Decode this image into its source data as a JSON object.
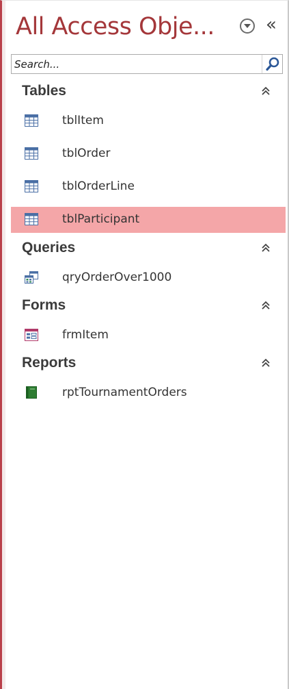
{
  "pane": {
    "title": "All Access Obje...",
    "accent_color": "#a4373a",
    "selection_color": "#f4a6a8"
  },
  "search": {
    "placeholder": "Search..."
  },
  "groups": [
    {
      "label": "Tables",
      "items": [
        "tblItem",
        "tblOrder",
        "tblOrderLine",
        "tblParticipant"
      ],
      "icon": "table-icon"
    },
    {
      "label": "Queries",
      "items": [
        "qryOrderOver1000"
      ],
      "icon": "query-icon"
    },
    {
      "label": "Forms",
      "items": [
        "frmItem"
      ],
      "icon": "form-icon"
    },
    {
      "label": "Reports",
      "items": [
        "rptTournamentOrders"
      ],
      "icon": "report-icon"
    }
  ],
  "selected_item": "tblParticipant"
}
